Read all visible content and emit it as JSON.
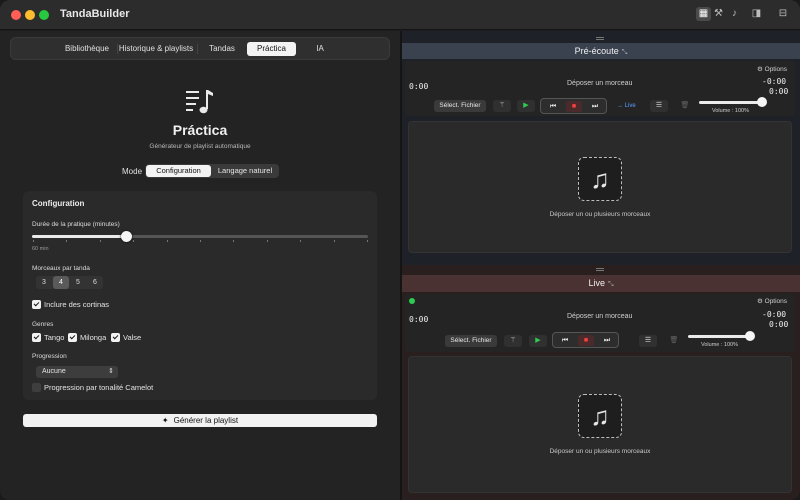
{
  "app": {
    "title": "TandaBuilder",
    "toolbar_icons": [
      "grid-icon",
      "hammer-icon",
      "music-note-icon",
      "sidebar-icon",
      "layout-icon"
    ]
  },
  "tabs": [
    "Bibliothèque",
    "Historique & playlists",
    "Tandas",
    "Práctica",
    "IA"
  ],
  "active_tab": "Práctica",
  "practica": {
    "title": "Práctica",
    "subtitle": "Générateur de playlist automatique",
    "mode_label": "Mode",
    "mode_options": [
      "Configuration",
      "Langage naturel"
    ],
    "mode_selected": "Configuration",
    "config": {
      "section_title": "Configuration",
      "duration_label": "Durée de la pratique (minutes)",
      "duration_value_text": "60 min",
      "duration_value": 60,
      "duration_fraction": 0.28,
      "per_tanda_label": "Morceaux par tanda",
      "per_tanda_options": [
        "3",
        "4",
        "5",
        "6"
      ],
      "per_tanda_selected": "4",
      "cortinas_label": "Inclure des cortinas",
      "cortinas_checked": true,
      "genres_label": "Genres",
      "genres": [
        {
          "label": "Tango",
          "checked": true
        },
        {
          "label": "Milonga",
          "checked": true
        },
        {
          "label": "Valse",
          "checked": true
        }
      ],
      "progression_label": "Progression",
      "progression_value": "Aucune",
      "camelot_label": "Progression par tonalité Camelot",
      "camelot_checked": false
    },
    "generate_button": "Générer la playlist"
  },
  "preview": {
    "title": "Pré-écoute",
    "options_label": "Options",
    "drop_track": "Déposer un morceau",
    "time_elapsed": "0:00",
    "time_remaining": "-0:00",
    "time_total": "0:00",
    "select_file": "Sélect. Fichier",
    "live_label": "→ Live",
    "volume_label": "Volume : 100%",
    "volume": 1.0,
    "drop_zone_text": "Déposer un ou plusieurs morceaux"
  },
  "live": {
    "title": "Live",
    "options_label": "Options",
    "drop_track": "Déposer un morceau",
    "time_elapsed": "0:00",
    "time_remaining": "-0:00",
    "time_total": "0:00",
    "select_file": "Sélect. Fichier",
    "volume_label": "Volume : 100%",
    "volume": 1.0,
    "drop_zone_text": "Déposer un ou plusieurs morceaux"
  },
  "colors": {
    "live_indicator": "#2ecc50",
    "stop_red": "#ff4040",
    "live_link": "#5aa0ff",
    "preview_header": "#3a4250",
    "live_header": "#4a3232"
  }
}
